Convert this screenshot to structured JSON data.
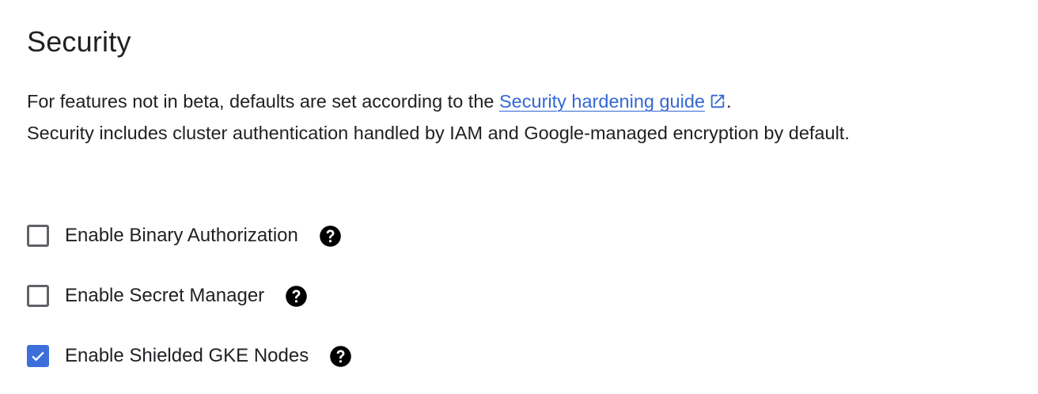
{
  "section": {
    "title": "Security",
    "description": {
      "before_link": "For features not in beta, defaults are set according to the ",
      "link_text": "Security hardening guide",
      "after_link": ".",
      "rest": "Security includes cluster authentication handled by IAM and Google-managed encryption by default."
    }
  },
  "options": [
    {
      "label": "Enable Binary Authorization",
      "checked": false,
      "help_icon": "help-circle-icon"
    },
    {
      "label": "Enable Secret Manager",
      "checked": false,
      "help_icon": "help-circle-icon"
    },
    {
      "label": "Enable Shielded GKE Nodes",
      "checked": true,
      "help_icon": "help-circle-icon"
    }
  ],
  "colors": {
    "link": "#3367d6",
    "checkbox_checked": "#3c6fd9",
    "checkbox_border": "#5f6368",
    "text": "#202124"
  }
}
